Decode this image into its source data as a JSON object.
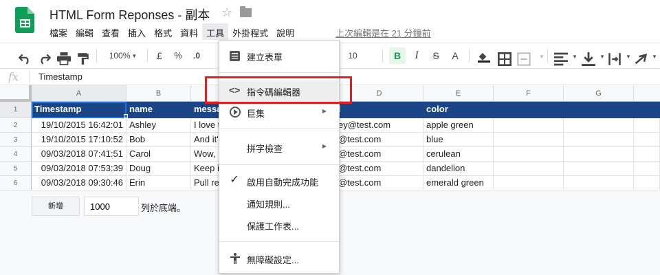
{
  "doc": {
    "title": "HTML Form Reponses - 副本",
    "star_icon": "star-outline-icon",
    "folder_icon": "folder-icon",
    "last_edit": "上次編輯是在 21 分鐘前"
  },
  "menubar": [
    "檔案",
    "編輯",
    "查看",
    "插入",
    "格式",
    "資料",
    "工具",
    "外掛程式",
    "說明"
  ],
  "toolbar": {
    "zoom": "100%",
    "currency": "£",
    "percent": "%",
    "decrease_decimal": ".0",
    "font_size": "10",
    "bold": "B",
    "italic": "I",
    "strike": "S"
  },
  "formula_bar": {
    "fx": "fx",
    "value": "Timestamp"
  },
  "grid": {
    "columns": [
      "A",
      "B",
      "C",
      "D",
      "E",
      "F",
      "G"
    ],
    "row_numbers": [
      "1",
      "2",
      "3",
      "4",
      "5",
      "6"
    ],
    "header_row": [
      "Timestamp",
      "name",
      "messa",
      "l",
      "color"
    ],
    "rows": [
      [
        "19/10/2015 16:42:01",
        "Ashley",
        "I love t",
        "ey@test.com",
        "apple green"
      ],
      [
        "19/10/2015 17:10:52",
        "Bob",
        "And it'",
        "@test.com",
        "blue"
      ],
      [
        "09/03/2018 07:41:51",
        "Carol",
        "Wow, ",
        "@test.com",
        "cerulean"
      ],
      [
        "09/03/2018 07:53:39",
        "Doug",
        "Keep i",
        "@test.com",
        "dandelion"
      ],
      [
        "09/03/2018 09:30:46",
        "Erin",
        "Pull re",
        "@test.com",
        "emerald green"
      ]
    ],
    "add_button": "新增",
    "add_rows_value": "1000",
    "add_rows_suffix": "列於底端。",
    "header_color": "#1c4587"
  },
  "tools_menu": {
    "items": [
      {
        "label": "建立表單",
        "icon": "form-icon"
      },
      {
        "label": "指令碼編輯器",
        "icon": "code-icon"
      },
      {
        "label": "巨集",
        "icon": "play-circle-icon",
        "submenu": true
      },
      {
        "label": "拼字檢查",
        "icon": "",
        "submenu": true
      },
      {
        "label": "啟用自動完成功能",
        "icon": "check-icon"
      },
      {
        "label": "通知規則...",
        "icon": ""
      },
      {
        "label": "保護工作表...",
        "icon": ""
      },
      {
        "label": "無障礙設定...",
        "icon": "accessibility-icon"
      }
    ],
    "highlight_color": "#e02020"
  }
}
